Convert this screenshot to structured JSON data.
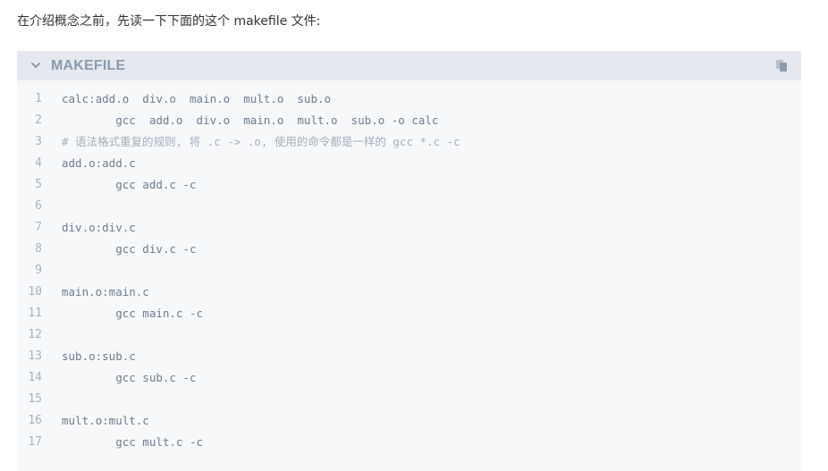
{
  "intro_text": "在介绍概念之前，先读一下下面的这个 makefile 文件:",
  "code_block": {
    "language_label": "MAKEFILE",
    "collapse_icon": "chevron-down-icon",
    "copy_icon": "copy-icon",
    "lines": [
      {
        "number": "1",
        "text": "calc:add.o  div.o  main.o  mult.o  sub.o",
        "kind": "code"
      },
      {
        "number": "2",
        "text": "        gcc  add.o  div.o  main.o  mult.o  sub.o -o calc",
        "kind": "code"
      },
      {
        "number": "3",
        "text": "# 语法格式重复的规则, 将 .c -> .o, 使用的命令都是一样的 gcc *.c -c",
        "kind": "comment"
      },
      {
        "number": "4",
        "text": "add.o:add.c",
        "kind": "code"
      },
      {
        "number": "5",
        "text": "        gcc add.c -c",
        "kind": "code"
      },
      {
        "number": "6",
        "text": "",
        "kind": "code"
      },
      {
        "number": "7",
        "text": "div.o:div.c",
        "kind": "code"
      },
      {
        "number": "8",
        "text": "        gcc div.c -c",
        "kind": "code"
      },
      {
        "number": "9",
        "text": "",
        "kind": "code"
      },
      {
        "number": "10",
        "text": "main.o:main.c",
        "kind": "code"
      },
      {
        "number": "11",
        "text": "        gcc main.c -c",
        "kind": "code"
      },
      {
        "number": "12",
        "text": "",
        "kind": "code"
      },
      {
        "number": "13",
        "text": "sub.o:sub.c",
        "kind": "code"
      },
      {
        "number": "14",
        "text": "        gcc sub.c -c",
        "kind": "code"
      },
      {
        "number": "15",
        "text": "",
        "kind": "code"
      },
      {
        "number": "16",
        "text": "mult.o:mult.c",
        "kind": "code"
      },
      {
        "number": "17",
        "text": "        gcc mult.c -c",
        "kind": "code"
      }
    ]
  }
}
